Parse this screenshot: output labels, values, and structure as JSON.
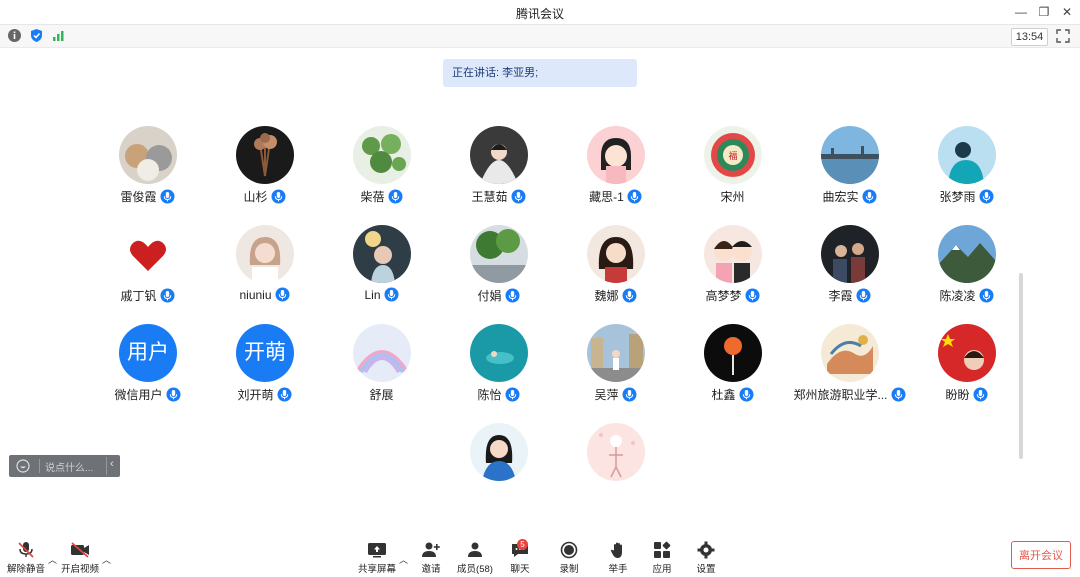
{
  "window": {
    "title": "腾讯会议"
  },
  "infobar": {
    "clock": "13:54"
  },
  "speaker_banner": "正在讲话: 李亚男;",
  "participants": [
    {
      "name": "雷俊霞",
      "mic": true,
      "avatar": "cats-photo"
    },
    {
      "name": "山杉",
      "mic": true,
      "avatar": "dried-flowers-photo"
    },
    {
      "name": "柴蓓",
      "mic": true,
      "avatar": "plants-photo"
    },
    {
      "name": "王慧茹",
      "mic": true,
      "avatar": "bride-photo"
    },
    {
      "name": "藏思-1",
      "mic": true,
      "avatar": "cartoon-girl"
    },
    {
      "name": "宋州",
      "mic": false,
      "avatar": "ornament-art"
    },
    {
      "name": "曲宏实",
      "mic": true,
      "avatar": "bridge-photo"
    },
    {
      "name": "张梦雨",
      "mic": true,
      "avatar": "person-photo"
    },
    {
      "name": "戚丁钒",
      "mic": true,
      "avatar": "red-heart"
    },
    {
      "name": "niuniu",
      "mic": true,
      "avatar": "girl-photo"
    },
    {
      "name": "Lin",
      "mic": true,
      "avatar": "girl-dark-photo"
    },
    {
      "name": "付娟",
      "mic": true,
      "avatar": "tree-photo"
    },
    {
      "name": "魏娜",
      "mic": true,
      "avatar": "woman-photo"
    },
    {
      "name": "高梦梦",
      "mic": true,
      "avatar": "couple-cartoon"
    },
    {
      "name": "李霞",
      "mic": true,
      "avatar": "group-photo"
    },
    {
      "name": "陈凌凌",
      "mic": true,
      "avatar": "mountain-photo"
    },
    {
      "name": "微信用户",
      "mic": true,
      "avatar": "text",
      "avatar_text": "用户"
    },
    {
      "name": "刘开萌",
      "mic": true,
      "avatar": "text",
      "avatar_text": "开萌"
    },
    {
      "name": "舒展",
      "mic": false,
      "avatar": "rainbow-photo"
    },
    {
      "name": "陈怡",
      "mic": true,
      "avatar": "sea-photo"
    },
    {
      "name": "吴萍",
      "mic": true,
      "avatar": "street-photo"
    },
    {
      "name": "杜鑫",
      "mic": true,
      "avatar": "lollipop-art"
    },
    {
      "name": "郑州旅游职业学...",
      "mic": true,
      "avatar": "painting-art"
    },
    {
      "name": "盼盼",
      "mic": true,
      "avatar": "flag-photo"
    },
    {
      "name": "",
      "mic": false,
      "avatar": "woman-blue-photo"
    },
    {
      "name": "",
      "mic": false,
      "avatar": "pink-sketch"
    }
  ],
  "chat": {
    "placeholder": "说点什么..."
  },
  "toolbar": {
    "unmute": "解除静音",
    "start_video": "开启视频",
    "share_screen": "共享屏幕",
    "invite": "邀请",
    "members": "成员(58)",
    "chat": "聊天",
    "chat_badge": "5",
    "record": "录制",
    "raise_hand": "举手",
    "apps": "应用",
    "settings": "设置",
    "leave": "离开会议"
  },
  "colors": {
    "accent": "#1a7cf5",
    "leave": "#e25a4e",
    "banner": "#dde9fb"
  }
}
